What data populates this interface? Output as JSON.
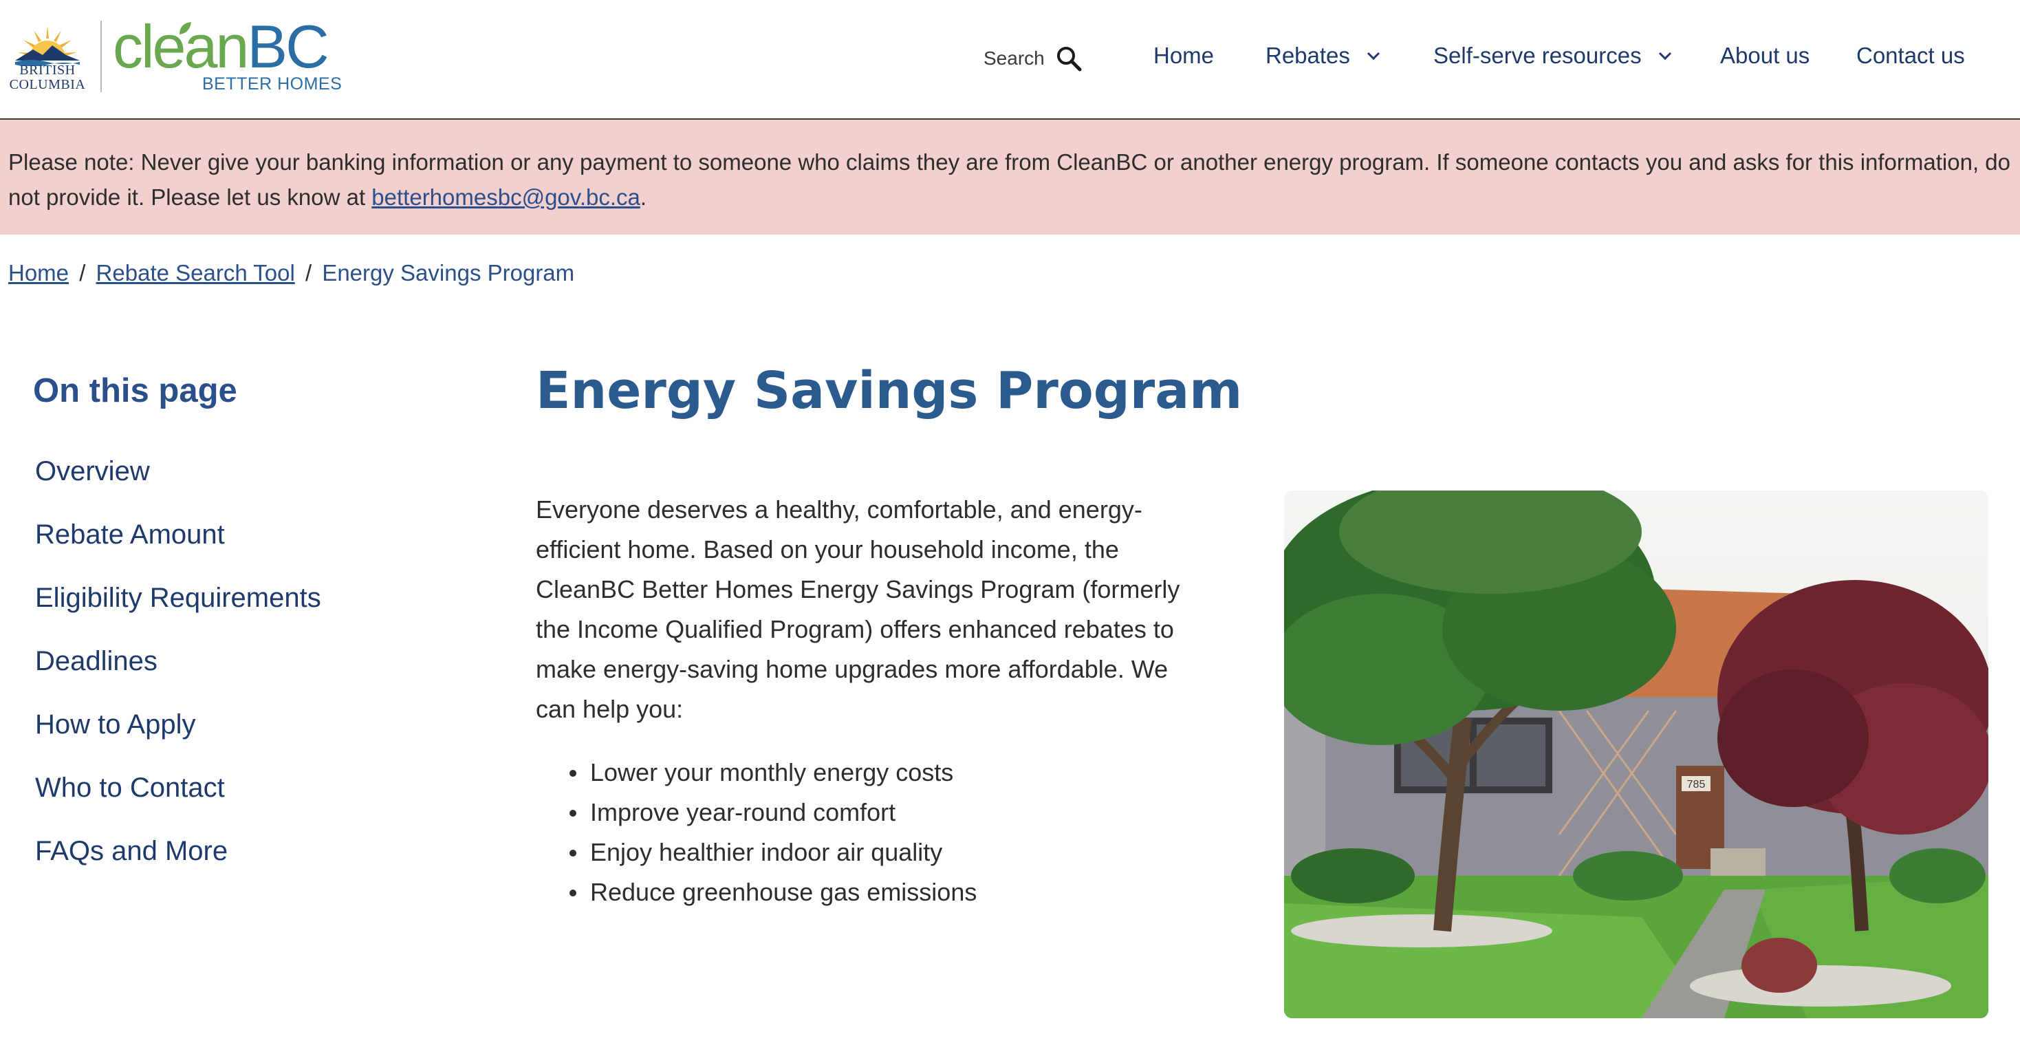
{
  "header": {
    "bc_logo_text": [
      "BRITISH",
      "COLUMBIA"
    ],
    "brand_clean": "clean",
    "brand_bc": "BC",
    "brand_sub": "BETTER HOMES",
    "search_label": "Search",
    "nav": [
      {
        "label": "Home",
        "has_dropdown": false
      },
      {
        "label": "Rebates",
        "has_dropdown": true
      },
      {
        "label": "Self-serve resources",
        "has_dropdown": true
      },
      {
        "label": "About us",
        "has_dropdown": false
      },
      {
        "label": "Contact us",
        "has_dropdown": false
      }
    ]
  },
  "alert": {
    "text_before": "Please note: Never give your banking information or any payment to someone who claims they are from CleanBC or another energy program. If someone contacts you and asks for this information, do not provide it. Please let us know at ",
    "email": "betterhomesbc@gov.bc.ca",
    "text_after": "."
  },
  "breadcrumb": {
    "items": [
      "Home",
      "Rebate Search Tool"
    ],
    "separator": "/",
    "current": "Energy Savings Program"
  },
  "sidebar": {
    "title": "On this page",
    "items": [
      "Overview",
      "Rebate Amount",
      "Eligibility Requirements",
      "Deadlines",
      "How to Apply",
      "Who to Contact",
      "FAQs and More"
    ]
  },
  "main": {
    "title": "Energy Savings Program",
    "intro_lines": [
      "Everyone deserves a healthy, comfortable, and energy-",
      "efficient home. Based on your household income, the",
      "CleanBC Better Homes Energy Savings Program (formerly",
      "the Income Qualified Program) offers enhanced rebates to",
      "make energy-saving home upgrades more affordable. We",
      "can help you:"
    ],
    "bullets": [
      "Lower your monthly energy costs",
      "Improve year-round comfort",
      "Enjoy healthier indoor air quality",
      "Reduce greenhouse gas emissions"
    ],
    "house_number": "785"
  },
  "colors": {
    "brand_green": "#6aa84f",
    "brand_blue": "#2b6ea6",
    "heading_blue": "#2b5a8e",
    "link_blue": "#2b4f8a",
    "alert_bg": "#f2d0cf"
  }
}
